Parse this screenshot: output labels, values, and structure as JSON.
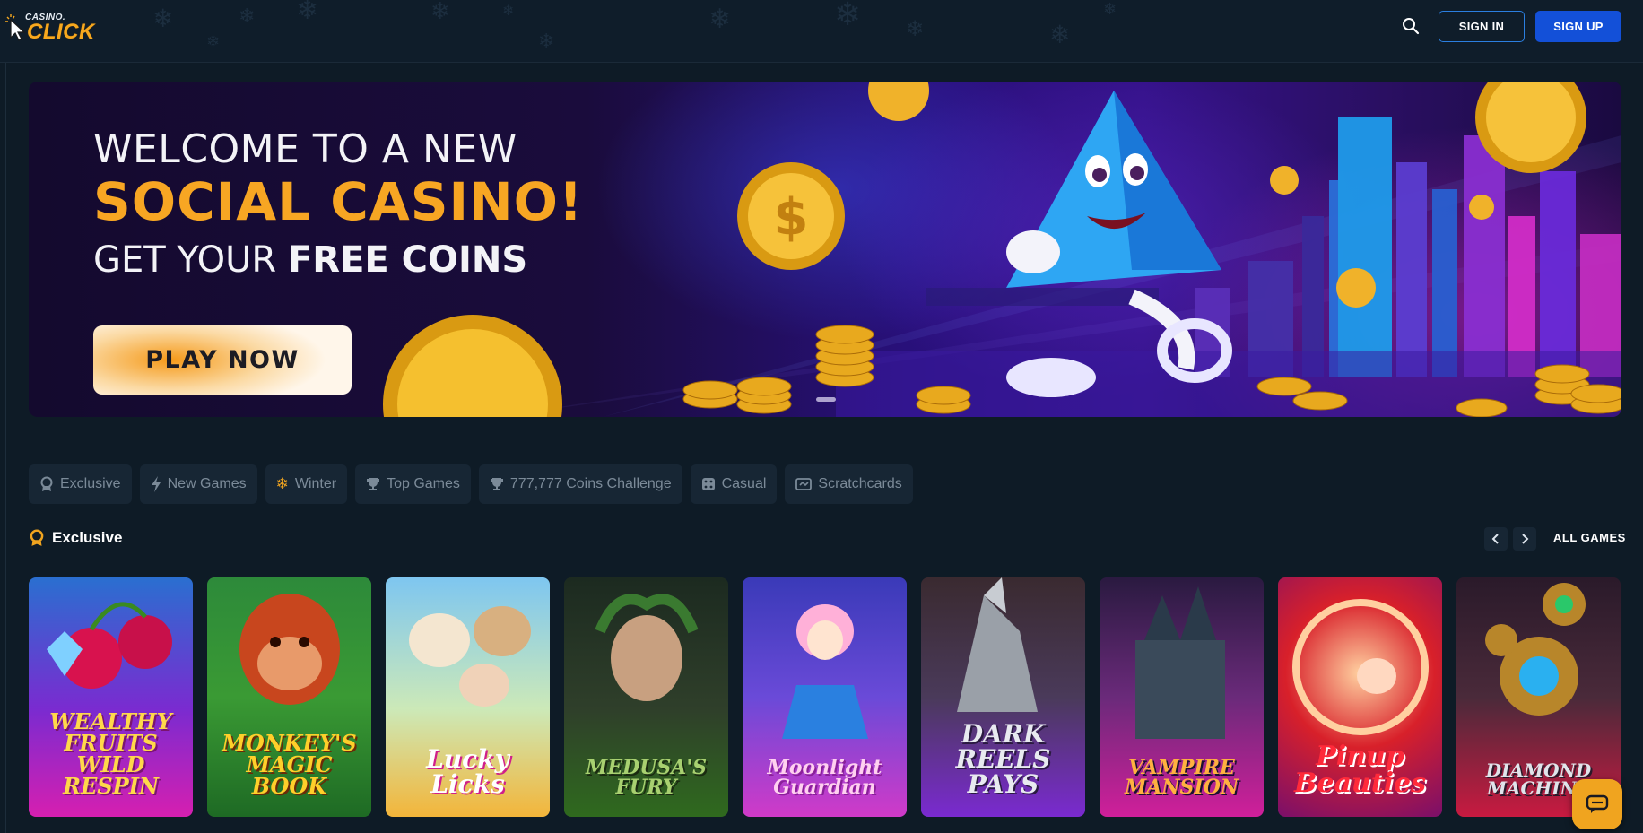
{
  "header": {
    "logo_small": "CASINO.",
    "logo_big": "CLICK",
    "search_icon": "search-icon",
    "sign_in": "SIGN IN",
    "sign_up": "SIGN UP"
  },
  "banner": {
    "line1": "WELCOME TO A NEW",
    "line2": "SOCIAL CASINO!",
    "line3_prefix": "GET YOUR ",
    "line3_bold": "FREE COINS",
    "cta": "PLAY NOW"
  },
  "categories": [
    {
      "label": "Exclusive",
      "icon": "medal-icon"
    },
    {
      "label": "New Games",
      "icon": "lightning-icon"
    },
    {
      "label": "Winter",
      "icon": "snowflake-icon"
    },
    {
      "label": "Top Games",
      "icon": "trophy-icon"
    },
    {
      "label": "777,777 Coins Challenge",
      "icon": "trophy-icon"
    },
    {
      "label": "Casual",
      "icon": "dice-icon"
    },
    {
      "label": "Scratchcards",
      "icon": "ticket-icon"
    }
  ],
  "section": {
    "title": "Exclusive",
    "all_games": "ALL GAMES",
    "accent": "#f0a41f"
  },
  "games": [
    {
      "name": "WEALTHY FRUITS WILD RESPIN"
    },
    {
      "name": "MONKEY'S MAGIC BOOK"
    },
    {
      "name": "Lucky Licks"
    },
    {
      "name": "MEDUSA'S FURY"
    },
    {
      "name": "Moonlight Guardian"
    },
    {
      "name": "DARK REELS PAYS"
    },
    {
      "name": "VAMPIRE MANSION"
    },
    {
      "name": "Pinup Beauties"
    },
    {
      "name": "DIAMOND MACHINE"
    }
  ],
  "colors": {
    "background": "#0e1b26",
    "primary_button": "#1350d8",
    "brand_orange": "#f7a623"
  }
}
